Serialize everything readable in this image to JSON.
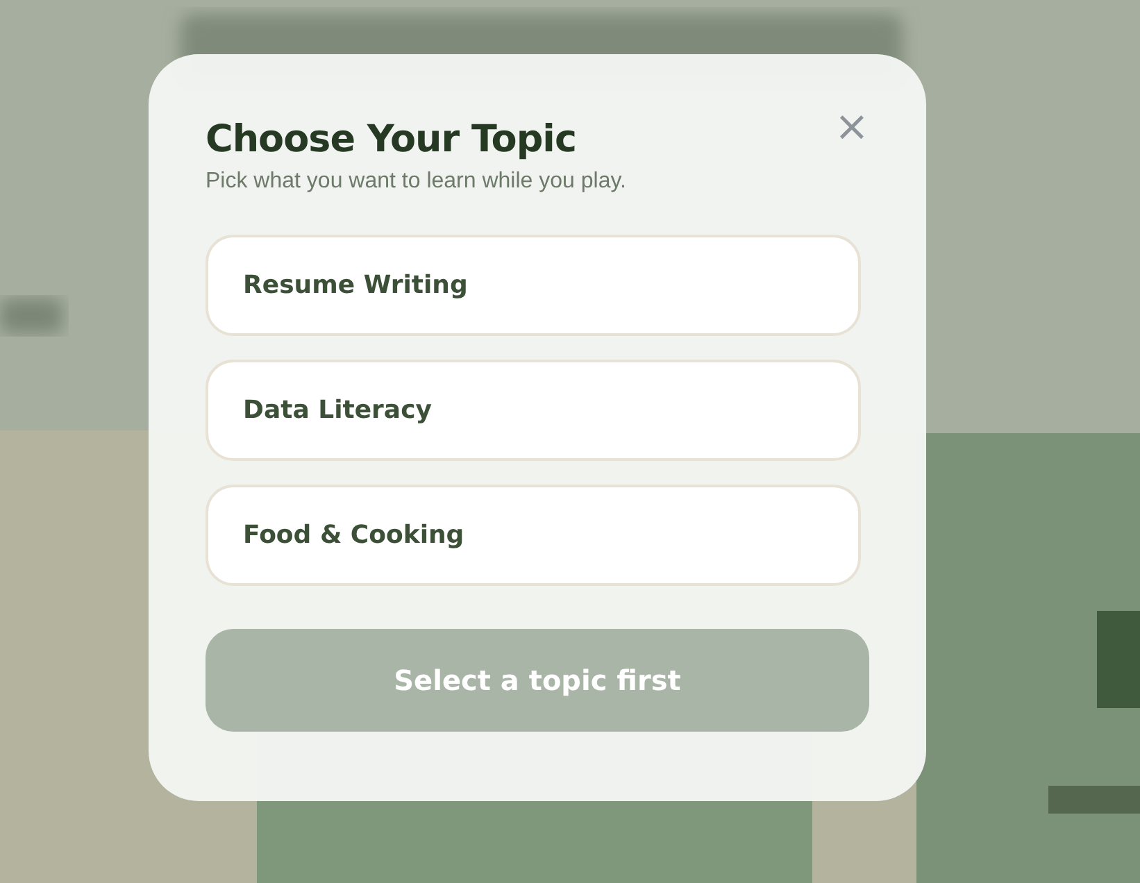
{
  "dialog": {
    "title": "Choose Your Topic",
    "subtitle": "Pick what you want to learn while you play.",
    "close": "×",
    "topics": [
      {
        "label": "Resume Writing",
        "selected": false
      },
      {
        "label": "Data Literacy",
        "selected": false
      },
      {
        "label": "Food & Cooking",
        "selected": false
      }
    ],
    "confirm": {
      "label": "Select a topic first",
      "disabled": true
    }
  }
}
